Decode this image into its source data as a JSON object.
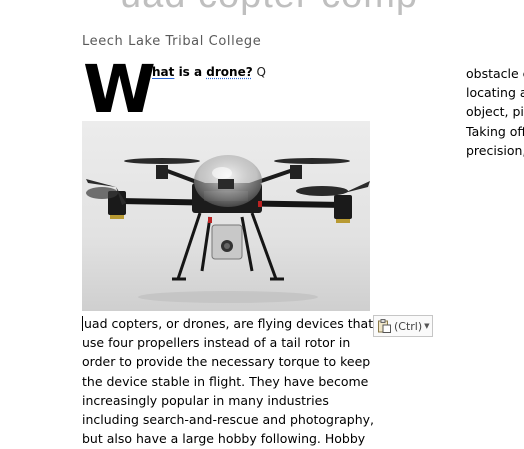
{
  "document": {
    "title_fragment": "uad copter comp",
    "subtitle": "Leech Lake Tribal College",
    "drop_cap": "W",
    "heading": {
      "part1": "hat",
      "part2": " is a ",
      "part3": "drone?",
      "part4": " Q"
    },
    "image_alt": "quadcopter drone photo",
    "body_lines": [
      "uad copters, or drones, are flying devices that",
      "use four propellers instead of a tail rotor in",
      "order to provide the necessary torque to keep",
      "the device stable in flight. They have become",
      "increasingly popular in many industries",
      "including search-and-rescue and photography,",
      "but also have a large hobby following. Hobby"
    ],
    "right_column_lines": [
      "obstacle c",
      "locating a",
      "object, pic",
      "Taking off",
      "precision,"
    ]
  },
  "paste_options": {
    "label": "(Ctrl)",
    "icon": "clipboard-paste-icon",
    "arrow_icon": "dropdown-arrow-icon"
  }
}
